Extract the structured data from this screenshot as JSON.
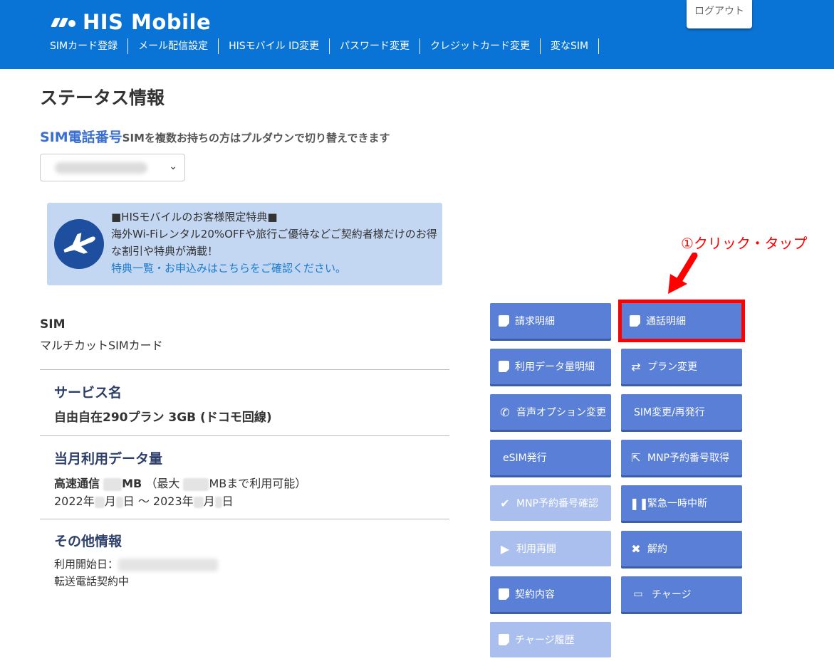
{
  "header": {
    "logo_text": "HIS Mobile",
    "logout_label": "ログアウト",
    "nav": [
      "SIMカード登録",
      "メール配信設定",
      "HISモバイル ID変更",
      "パスワード変更",
      "クレジットカード変更",
      "変なSIM"
    ]
  },
  "page_title": "ステータス情報",
  "sim_selector": {
    "label": "SIM電話番号",
    "note": "SIMを複数お持ちの方はプルダウンで切り替えできます"
  },
  "promo": {
    "line1": "■HISモバイルのお客様限定特典■",
    "line2": "海外Wi-Fiレンタル20%OFFや旅行ご優待などご契約者様だけのお得な割引や特典が満載！",
    "link": "特典一覧・お申込みはこちらをご確認ください。"
  },
  "sim": {
    "title": "SIM",
    "type": "マルチカットSIMカード"
  },
  "service": {
    "title": "サービス名",
    "name": "自由自在290プラン 3GB (ドコモ回線)"
  },
  "data_usage": {
    "title": "当月利用データ量",
    "prefix": "高速通信",
    "unit": "MB",
    "max_prefix": "（最大",
    "max_suffix": "MBまで利用可能）",
    "period_a": "2022年",
    "period_b": "月",
    "period_c": "日 ～ 2023年",
    "period_d": "月",
    "period_e": "日"
  },
  "other": {
    "title": "その他情報",
    "start_label": "利用開始日：",
    "forwarding": "転送電話契約中"
  },
  "buttons": {
    "billing": "請求明細",
    "call": "通話明細",
    "data": "利用データ量明細",
    "plan": "プラン変更",
    "voice": "音声オプション変更",
    "sim_change": "SIM変更/再発行",
    "esim": "eSIM発行",
    "mnp_get": "MNP予約番号取得",
    "mnp_check": "MNP予約番号確認",
    "suspend": "緊急一時中断",
    "resume": "利用再開",
    "cancel": "解約",
    "contract": "契約内容",
    "charge": "チャージ",
    "charge_history": "チャージ履歴"
  },
  "annotation": "①クリック・タップ",
  "colors": {
    "header": "#0a74d6",
    "button": "#5a7fd6",
    "button_disabled": "#aabfee",
    "highlight": "#ff0000"
  }
}
